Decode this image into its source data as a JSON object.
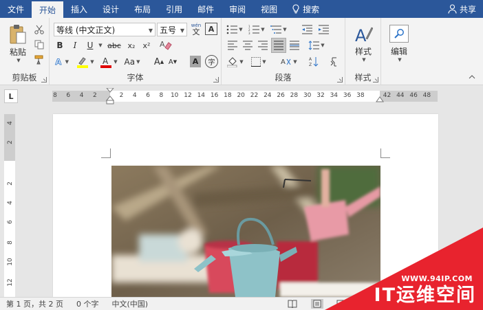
{
  "tabs": [
    {
      "label": "文件"
    },
    {
      "label": "开始"
    },
    {
      "label": "插入"
    },
    {
      "label": "设计"
    },
    {
      "label": "布局"
    },
    {
      "label": "引用"
    },
    {
      "label": "邮件"
    },
    {
      "label": "审阅"
    },
    {
      "label": "视图"
    }
  ],
  "search": {
    "label": "搜索"
  },
  "share": {
    "label": "共享"
  },
  "ribbon": {
    "clipboard": {
      "label": "剪贴板",
      "paste_label": "粘贴"
    },
    "font": {
      "label": "字体",
      "font_name": "等线 (中文正文)",
      "font_size": "五号",
      "phonetic_top": "wén",
      "phonetic_bottom": "文",
      "char_border": "A",
      "bold": "B",
      "italic": "I",
      "underline": "U",
      "strike": "abc",
      "subscript": "x₂",
      "superscript": "x²",
      "case": "Aa",
      "grow": "A",
      "shrink": "A",
      "shading": "A",
      "enclose": "字"
    },
    "paragraph": {
      "label": "段落"
    },
    "styles": {
      "label": "样式",
      "button": "样式"
    },
    "editing": {
      "button": "编辑"
    }
  },
  "ruler": {
    "selector": "L",
    "h_numbers": [
      "8",
      "6",
      "4",
      "2",
      "2",
      "4",
      "6",
      "8",
      "10",
      "12",
      "14",
      "16",
      "18",
      "20",
      "22",
      "24",
      "26",
      "28",
      "30",
      "32",
      "34",
      "36",
      "38",
      "42",
      "44",
      "46",
      "48"
    ],
    "v_numbers": [
      "4",
      "2",
      "2",
      "4",
      "6",
      "8",
      "10",
      "12"
    ]
  },
  "status": {
    "page": "第 1 页，共 2 页",
    "words": "0 个字",
    "lang": "中文(中国)"
  },
  "watermark": {
    "url": "WWW.94IP.COM",
    "brand": "IT运维空间"
  },
  "colors": {
    "title_blue": "#2b579a",
    "highlight_yellow": "#ffff00",
    "font_red": "#e00000",
    "watermark_red": "#e8232e"
  }
}
